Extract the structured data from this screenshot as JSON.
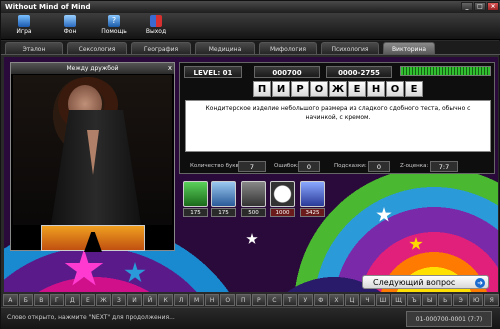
{
  "window": {
    "title": "Without Mind of Mind"
  },
  "toolbar": {
    "buttons": [
      {
        "label": "Игра",
        "icon": "game-icon",
        "color": "#2a7ad8"
      },
      {
        "label": "Фон",
        "icon": "background-icon",
        "color": "#3a8ae0"
      },
      {
        "label": "Помощь",
        "icon": "help-icon",
        "color": "#3a7ad0"
      },
      {
        "label": "Выход",
        "icon": "exit-icon",
        "color": "#c83030"
      }
    ]
  },
  "tabs": [
    "Эталон",
    "Сексология",
    "География",
    "Медицина",
    "Мифология",
    "Психология",
    "Викторина"
  ],
  "active_tab": "Викторина",
  "video": {
    "title": "Между дружбой",
    "close": "x"
  },
  "quiz": {
    "level": "LEVEL: 01",
    "score": "000700",
    "range": "0000-2755",
    "progress": 1.0,
    "word_letters": [
      "П",
      "И",
      "Р",
      "О",
      "Ж",
      "Е",
      "Н",
      "О",
      "Е"
    ],
    "definition": "Кондитерское изделие небольшого размера из сладкого сдобного теста, обычно с начинкой, с кремом.",
    "stats": {
      "letters_label": "Количество букв:",
      "letters": "7",
      "errors_label": "Ошибок:",
      "errors": "0",
      "hints_label": "Подсказки:",
      "hints": "0",
      "rating_label": "Z-оценка:",
      "rating": "7:7"
    }
  },
  "hints": [
    {
      "icon": "star-hint-icon",
      "cost": "175",
      "color": "#2a8a2a"
    },
    {
      "icon": "search-hint-icon",
      "cost": "175",
      "color": "#3a7ab8"
    },
    {
      "icon": "pause-hint-icon",
      "cost": "500",
      "color": "#555555"
    },
    {
      "icon": "clock-hint-icon",
      "cost": "1000",
      "color": "#8a2a2a"
    },
    {
      "icon": "shield-hint-icon",
      "cost": "3425",
      "color": "#3a5ac8"
    }
  ],
  "next_button": {
    "label": "Следующий вопрос"
  },
  "alphabet": [
    "А",
    "Б",
    "В",
    "Г",
    "Д",
    "Е",
    "Ж",
    "З",
    "И",
    "Й",
    "К",
    "Л",
    "М",
    "Н",
    "О",
    "П",
    "Р",
    "С",
    "Т",
    "У",
    "Ф",
    "Х",
    "Ц",
    "Ч",
    "Ш",
    "Щ",
    "Ъ",
    "Ы",
    "Ь",
    "Э",
    "Ю",
    "Я"
  ],
  "status": {
    "message": "Слово открыто, нажмите \"NEXT\" для продолжения...",
    "code": "01-000700-0001 (7:7)"
  }
}
